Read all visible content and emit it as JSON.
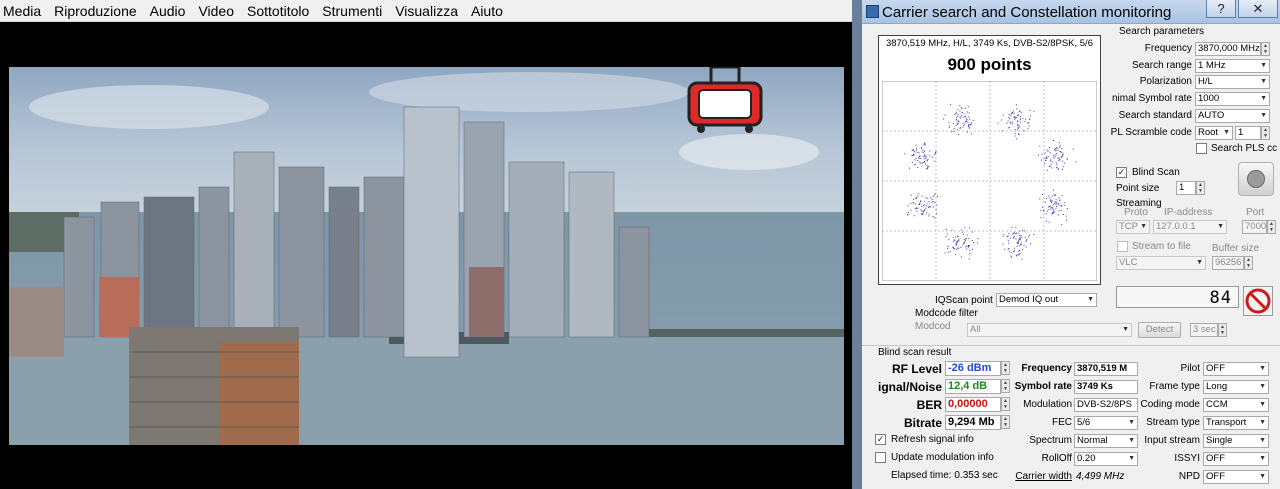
{
  "vlc": {
    "menu": [
      "Media",
      "Riproduzione",
      "Audio",
      "Video",
      "Sottotitolo",
      "Strumenti",
      "Visualizza",
      "Aiuto"
    ]
  },
  "window": {
    "title": "Carrier search and Constellation monitoring",
    "help_label": "?",
    "close_label": "✕"
  },
  "constellation": {
    "info": "3870,519 MHz, H/L, 3749 Ks, DVB-S2/8PSK, 5/6",
    "points_label": "900 points"
  },
  "search": {
    "section_title": "Search parameters",
    "frequency_label": "Frequency",
    "frequency_value": "3870,000 MHz",
    "range_label": "Search range",
    "range_value": "1 MHz",
    "polarization_label": "Polarization",
    "polarization_value": "H/L",
    "symbol_rate_label": "nimal Symbol rate",
    "symbol_rate_value": "1000",
    "standard_label": "Search standard",
    "standard_value": "AUTO",
    "pl_label": "PL Scramble code",
    "pl_mode": "Root",
    "pl_value": "1",
    "pls_label": "Search PLS cc",
    "blind_scan_label": "Blind Scan",
    "point_size_label": "Point size",
    "point_size_value": "1"
  },
  "streaming": {
    "title": "Streaming",
    "proto_header": "Proto",
    "ip_header": "IP-address",
    "port_header": "Port",
    "proto_value": "TCP",
    "ip_value": "127.0.0.1",
    "port_value": "7000",
    "stream_to_file_label": "Stream to file",
    "buffer_label": "Buffer size",
    "player_value": "VLC",
    "buffer_value": "96256"
  },
  "iqscan": {
    "label": "IQScan point",
    "value": "Demod IQ out",
    "counter": "84"
  },
  "modcode": {
    "title": "Modcode filter",
    "label": "Modcod",
    "value": "All",
    "detect_label": "Detect",
    "secs_value": "3 sec"
  },
  "result": {
    "title": "Blind scan result",
    "rf_label": "RF Level",
    "rf_value": "-26 dBm",
    "snr_label": "ignal/Noise",
    "snr_value": "12,4 dB",
    "ber_label": "BER",
    "ber_value": "0,00000",
    "bitrate_label": "Bitrate",
    "bitrate_value": "9,294 Mb",
    "refresh_label": "Refresh signal info",
    "update_label": "Update modulation info",
    "elapsed_label": "Elapsed time: 0.353 sec",
    "frequency_label": "Frequency",
    "frequency_value": "3870,519 M",
    "symbol_rate_label": "Symbol rate",
    "symbol_rate_value": "3749 Ks",
    "modulation_label": "Modulation",
    "modulation_value": "DVB-S2/8PS",
    "fec_label": "FEC",
    "fec_value": "5/6",
    "spectrum_label": "Spectrum",
    "spectrum_value": "Normal",
    "rolloff_label": "RollOff",
    "rolloff_value": "0.20",
    "carrier_width_label": "Carrier width",
    "carrier_width_value": "4,499 MHz",
    "pilot_label": "Pilot",
    "pilot_value": "OFF",
    "frame_label": "Frame type",
    "frame_value": "Long",
    "coding_label": "Coding mode",
    "coding_value": "CCM",
    "stream_type_label": "Stream type",
    "stream_type_value": "Transport",
    "input_stream_label": "Input stream",
    "input_stream_value": "Single",
    "issyi_label": "ISSYI",
    "issyi_value": "OFF",
    "npd_label": "NPD",
    "npd_value": "OFF"
  },
  "colors": {
    "rf_value": "#1f4fd0",
    "snr_value": "#1a8a1a",
    "ber_value": "#cc1111",
    "counter_text": "#000000",
    "stop_red": "#cc1a1a"
  }
}
